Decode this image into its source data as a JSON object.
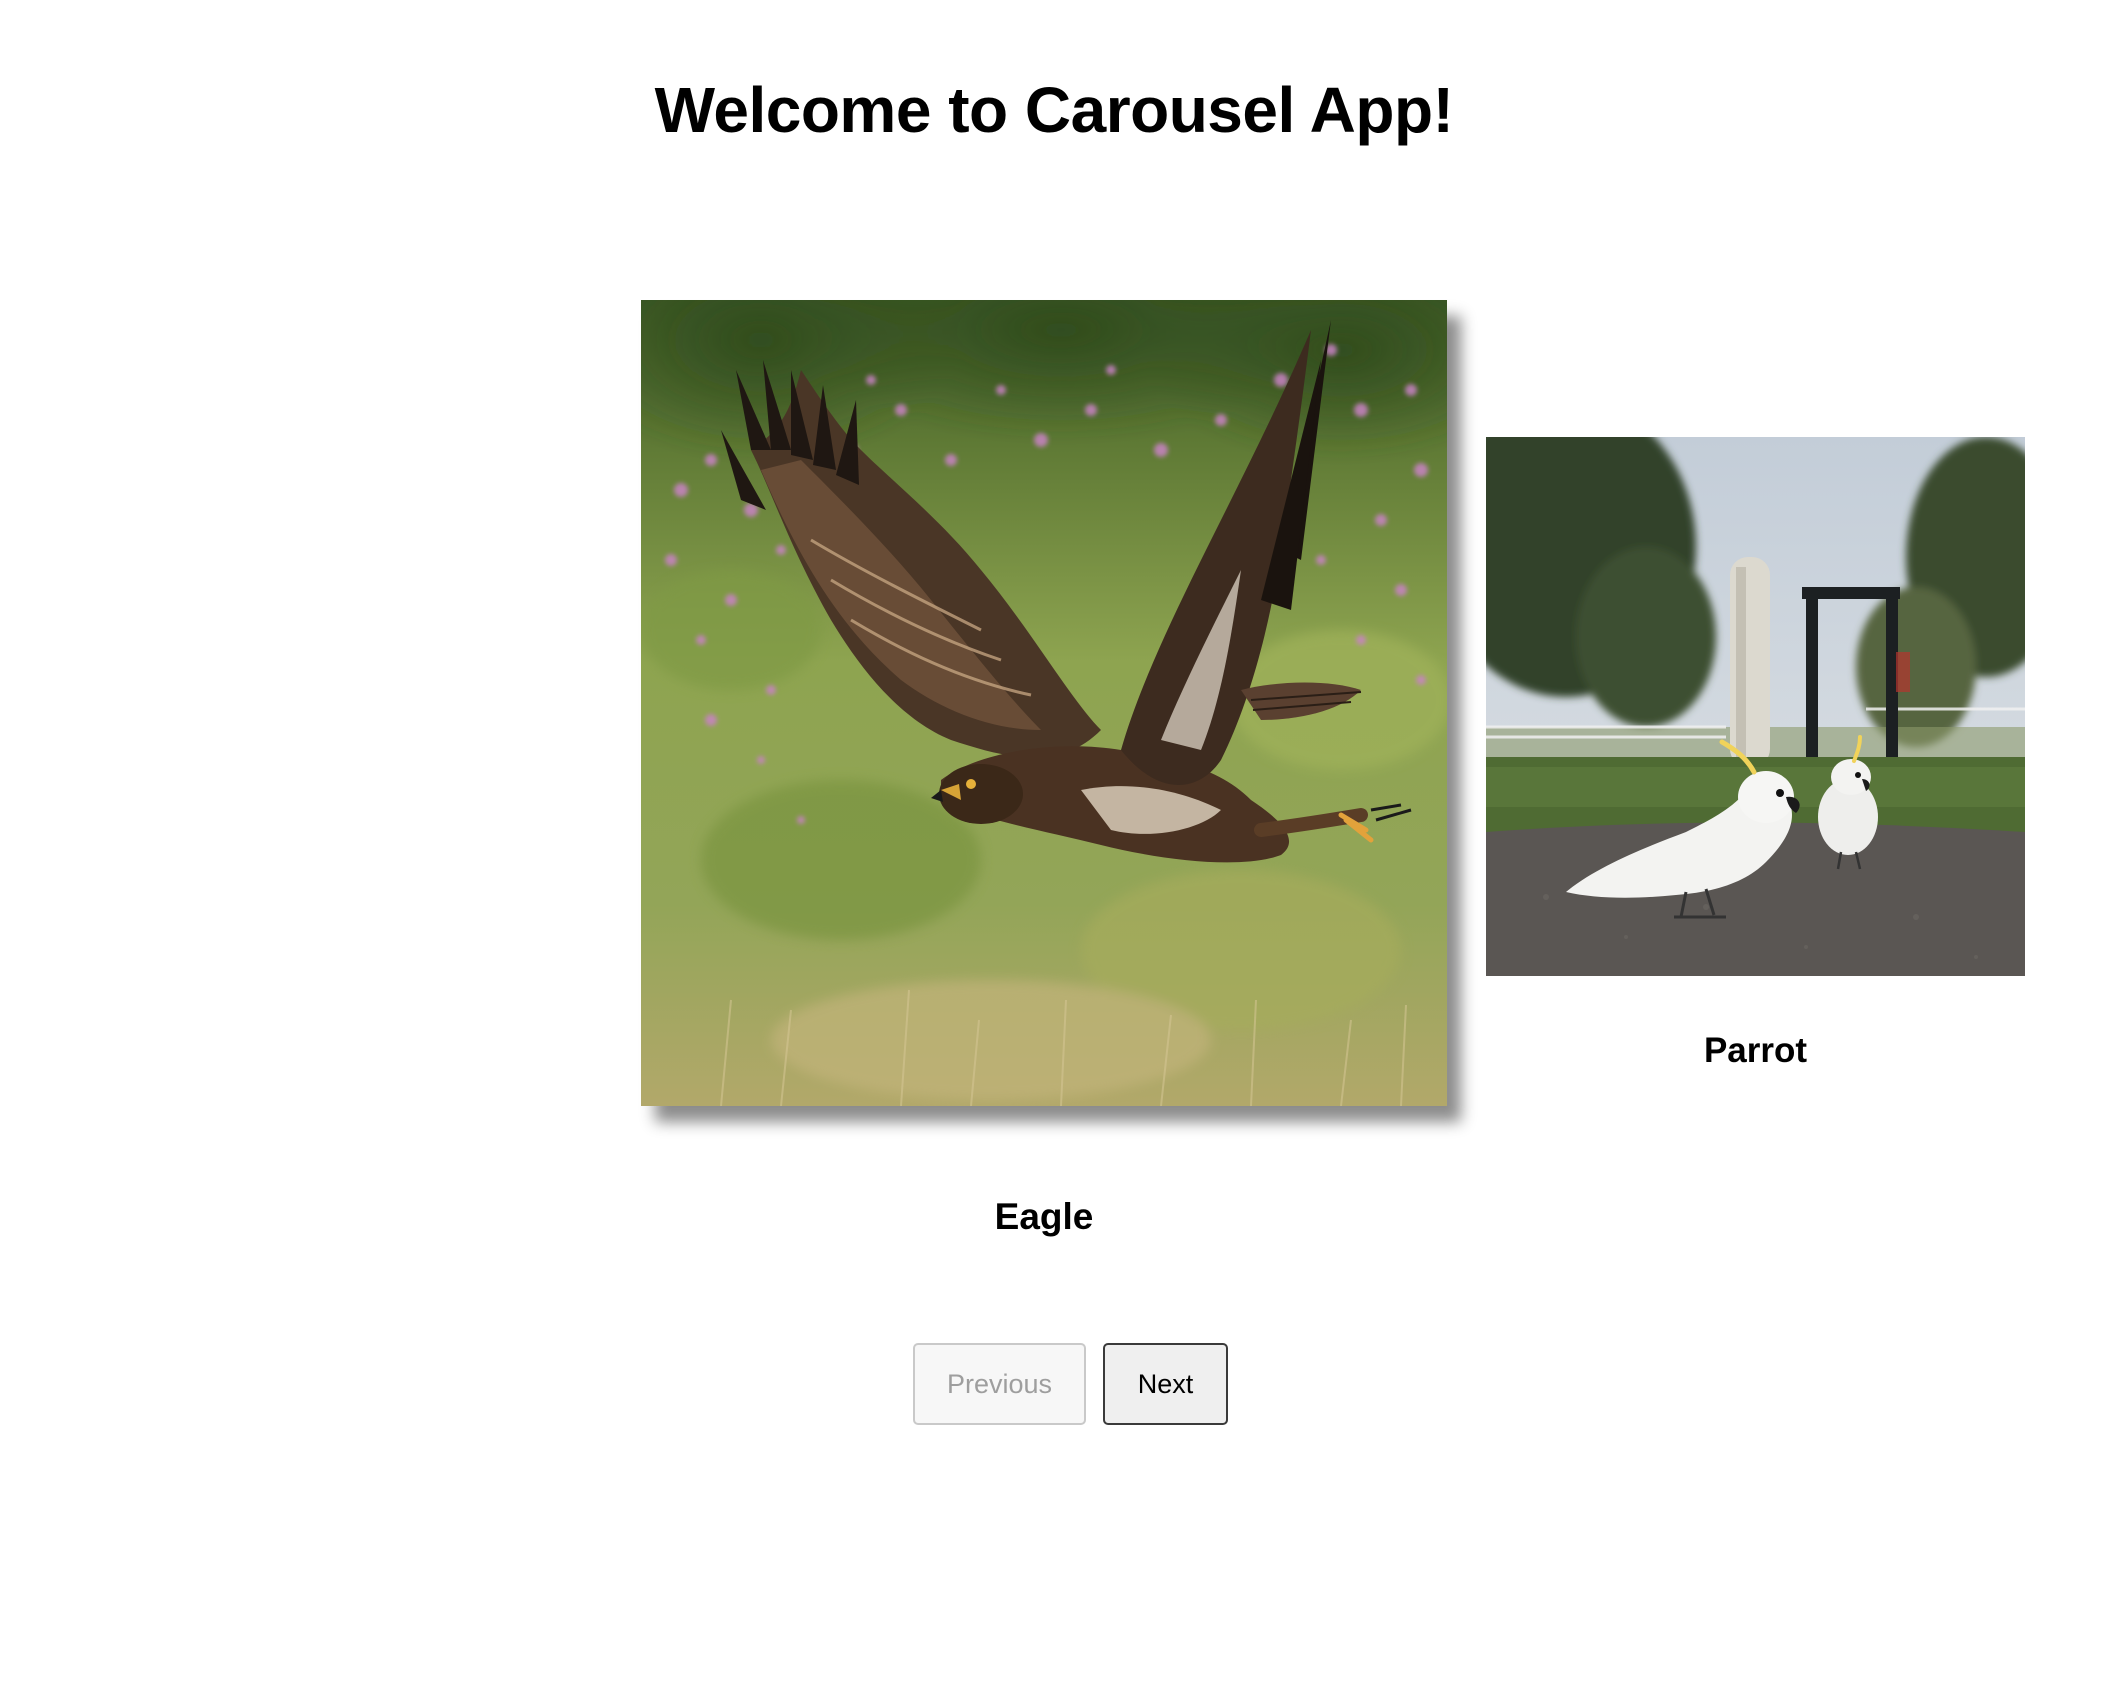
{
  "app": {
    "title": "Welcome to Carousel App!"
  },
  "carousel": {
    "current_index": 0,
    "slides": [
      {
        "caption": "Eagle",
        "image": "eagle-in-flight-photo",
        "state": "active"
      },
      {
        "caption": "Parrot",
        "image": "cockatoos-on-path-photo",
        "state": "next"
      }
    ]
  },
  "controls": {
    "previous_label": "Previous",
    "previous_disabled": true,
    "next_label": "Next",
    "next_disabled": false
  }
}
